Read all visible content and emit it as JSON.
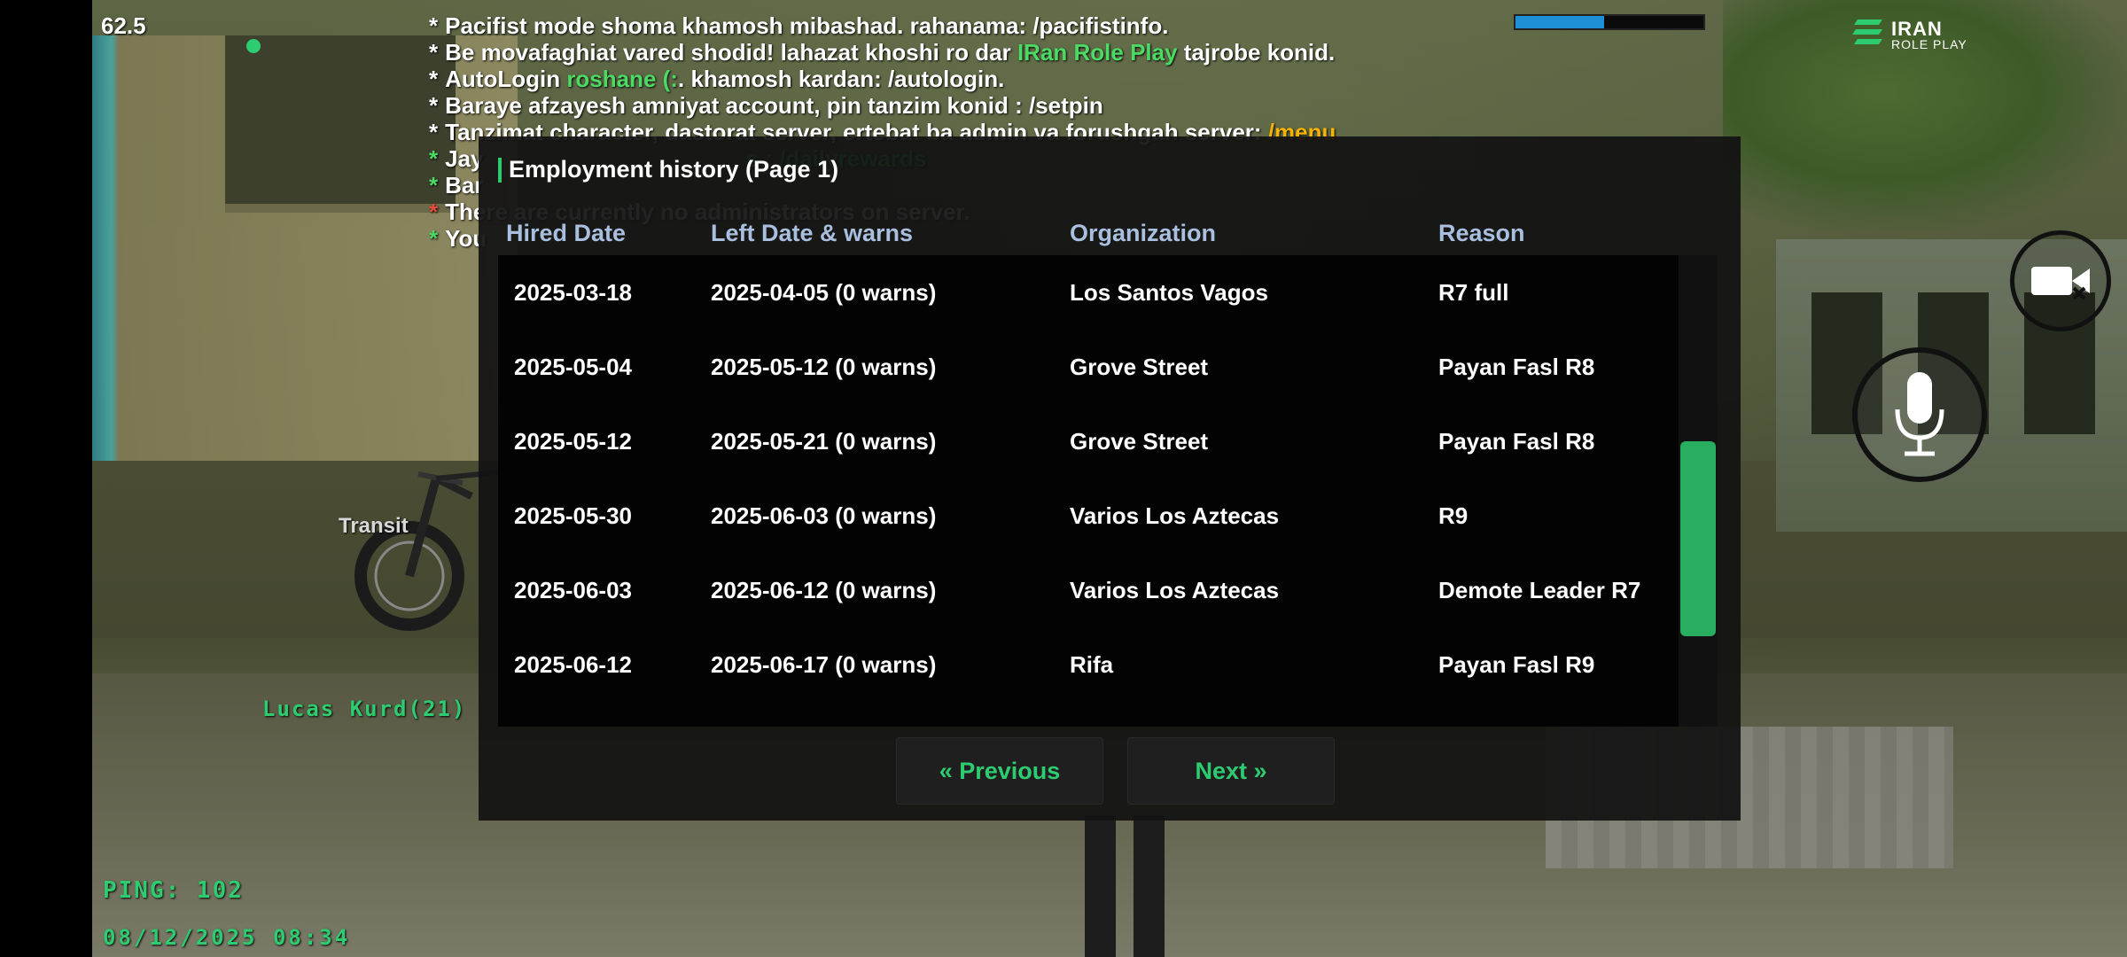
{
  "hud": {
    "fps": "62.5",
    "ping": "PING: 102",
    "datetime": "08/12/2025 08:34",
    "player_name": "Lucas Kurd(21)",
    "vehicle_label": "Transit",
    "health_fraction": 0.47,
    "logo": {
      "line1": "IRAN",
      "line2": "ROLE PLAY"
    },
    "colors": {
      "accent_green": "#2ecc71",
      "health_blue": "#1e90d6"
    }
  },
  "chat": [
    {
      "bullet": "*",
      "bullet_color": "white",
      "parts": [
        {
          "text": "Pacifist mode shoma khamosh mibashad. rahanama: /pacifistinfo.",
          "color": "white"
        }
      ]
    },
    {
      "bullet": "*",
      "bullet_color": "white",
      "parts": [
        {
          "text": "Be movafaghiat vared shodid! lahazat khoshi ro dar ",
          "color": "white"
        },
        {
          "text": "IRan Role Play",
          "color": "green"
        },
        {
          "text": " tajrobe konid.",
          "color": "white"
        }
      ]
    },
    {
      "bullet": "*",
      "bullet_color": "white",
      "parts": [
        {
          "text": "AutoLogin ",
          "color": "white"
        },
        {
          "text": "roshane (:",
          "color": "green"
        },
        {
          "text": ". khamosh kardan: /autologin.",
          "color": "white"
        }
      ]
    },
    {
      "bullet": "*",
      "bullet_color": "white",
      "parts": [
        {
          "text": "Baraye afzayesh amniyat account, pin tanzim konid : /setpin",
          "color": "white"
        }
      ]
    },
    {
      "bullet": "*",
      "bullet_color": "white",
      "parts": [
        {
          "text": "Tanzimat character, dastorat server, ertebat ba admin va forushgah server: ",
          "color": "white"
        },
        {
          "text": "/menu",
          "color": "yellow"
        }
      ]
    },
    {
      "bullet": "*",
      "bullet_color": "green",
      "parts": [
        {
          "text": "Jay",
          "color": "white"
        },
        {
          "text": "                                         s : /dailyrewards",
          "color": "green"
        }
      ]
    },
    {
      "bullet": "*",
      "bullet_color": "green",
      "parts": [
        {
          "text": "Bar",
          "color": "white"
        }
      ]
    },
    {
      "bullet": "*",
      "bullet_color": "red",
      "parts": [
        {
          "text": "There are currently no administrators on server.",
          "color": "white"
        }
      ]
    },
    {
      "bullet": "*",
      "bullet_color": "green",
      "parts": [
        {
          "text": "You",
          "color": "white"
        }
      ]
    }
  ],
  "dialog": {
    "title": "Employment history (Page 1)",
    "columns": [
      "Hired Date",
      "Left Date & warns",
      "Organization",
      "Reason"
    ],
    "rows": [
      [
        "2025-03-18",
        "2025-04-05 (0 warns)",
        "Los Santos Vagos",
        "R7 full"
      ],
      [
        "2025-05-04",
        "2025-05-12 (0 warns)",
        "Grove Street",
        "Payan Fasl R8"
      ],
      [
        "2025-05-12",
        "2025-05-21 (0 warns)",
        "Grove Street",
        "Payan Fasl R8"
      ],
      [
        "2025-05-30",
        "2025-06-03 (0 warns)",
        "Varios Los Aztecas",
        "R9"
      ],
      [
        "2025-06-03",
        "2025-06-12 (0 warns)",
        "Varios Los Aztecas",
        "Demote Leader R7"
      ],
      [
        "2025-06-12",
        "2025-06-17 (0 warns)",
        "Rifa",
        "Payan Fasl R9"
      ]
    ],
    "prev_label": "« Previous",
    "next_label": "Next »",
    "header_color": "#a9bfdf"
  },
  "icons": {
    "camera": "video-camera-icon",
    "mic": "microphone-icon"
  }
}
